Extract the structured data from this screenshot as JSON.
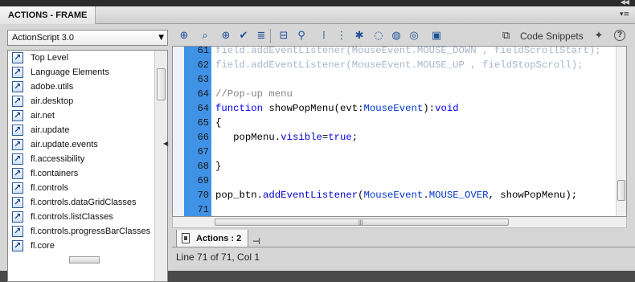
{
  "panel": {
    "title": "ACTIONS - FRAME",
    "collapse_icon": "double-chevron-right-icon",
    "menu_icon": "panel-menu-icon"
  },
  "version_select": {
    "value": "ActionScript 3.0"
  },
  "tree": {
    "items": [
      "Top Level",
      "Language Elements",
      "adobe.utils",
      "air.desktop",
      "air.net",
      "air.update",
      "air.update.events",
      "fl.accessibility",
      "fl.containers",
      "fl.controls",
      "fl.controls.dataGridClasses",
      "fl.controls.listClasses",
      "fl.controls.progressBarClasses",
      "fl.core"
    ]
  },
  "toolbar": {
    "buttons": [
      "add-statement-icon",
      "find-icon",
      "insert-target-path-icon",
      "check-syntax-icon",
      "auto-format-icon",
      "show-code-hint-icon",
      "debug-options-icon",
      "collapse-between-braces-icon",
      "collapse-selection-icon",
      "expand-all-icon",
      "apply-block-comment-icon",
      "apply-line-comment-icon",
      "remove-comment-icon",
      "show-hide-toolbox-icon"
    ],
    "code_snippets_label": "Code Snippets",
    "help_label": "?"
  },
  "editor": {
    "lines": [
      {
        "num": "61",
        "faded": true,
        "tokens": [
          {
            "t": "field.addEventListener(MouseEvent.MOUSE_DOWN , fieldScrollStart);",
            "c": "faded"
          }
        ]
      },
      {
        "num": "62",
        "faded": true,
        "tokens": [
          {
            "t": "field.addEventListener(MouseEvent.MOUSE_UP , fieldStopScroll);",
            "c": "faded"
          }
        ]
      },
      {
        "num": "63",
        "tokens": []
      },
      {
        "num": "64",
        "tokens": [
          {
            "t": "//Pop-up menu",
            "c": "cm"
          }
        ]
      },
      {
        "num": "64",
        "tokens": [
          {
            "t": "function",
            "c": "kw"
          },
          {
            "t": " showPopMenu(evt:",
            "c": ""
          },
          {
            "t": "MouseEvent",
            "c": "cls"
          },
          {
            "t": "):",
            "c": ""
          },
          {
            "t": "void",
            "c": "kw"
          }
        ]
      },
      {
        "num": "65",
        "tokens": [
          {
            "t": "{",
            "c": ""
          }
        ]
      },
      {
        "num": "66",
        "tokens": [
          {
            "t": "   popMenu.",
            "c": ""
          },
          {
            "t": "visible",
            "c": "fn"
          },
          {
            "t": "=",
            "c": ""
          },
          {
            "t": "true",
            "c": "bl"
          },
          {
            "t": ";",
            "c": ""
          }
        ]
      },
      {
        "num": "67",
        "tokens": []
      },
      {
        "num": "68",
        "tokens": [
          {
            "t": "}",
            "c": ""
          }
        ]
      },
      {
        "num": "69",
        "tokens": []
      },
      {
        "num": "70",
        "tokens": [
          {
            "t": "pop_btn.",
            "c": ""
          },
          {
            "t": "addEventListener",
            "c": "fn"
          },
          {
            "t": "(",
            "c": ""
          },
          {
            "t": "MouseEvent",
            "c": "cls"
          },
          {
            "t": ".",
            "c": ""
          },
          {
            "t": "MOUSE_OVER",
            "c": "cls"
          },
          {
            "t": ", showPopMenu);",
            "c": ""
          }
        ]
      },
      {
        "num": "71",
        "tokens": []
      }
    ]
  },
  "tab": {
    "label": "Actions : 2"
  },
  "status": {
    "text": "Line 71 of 71, Col 1"
  }
}
